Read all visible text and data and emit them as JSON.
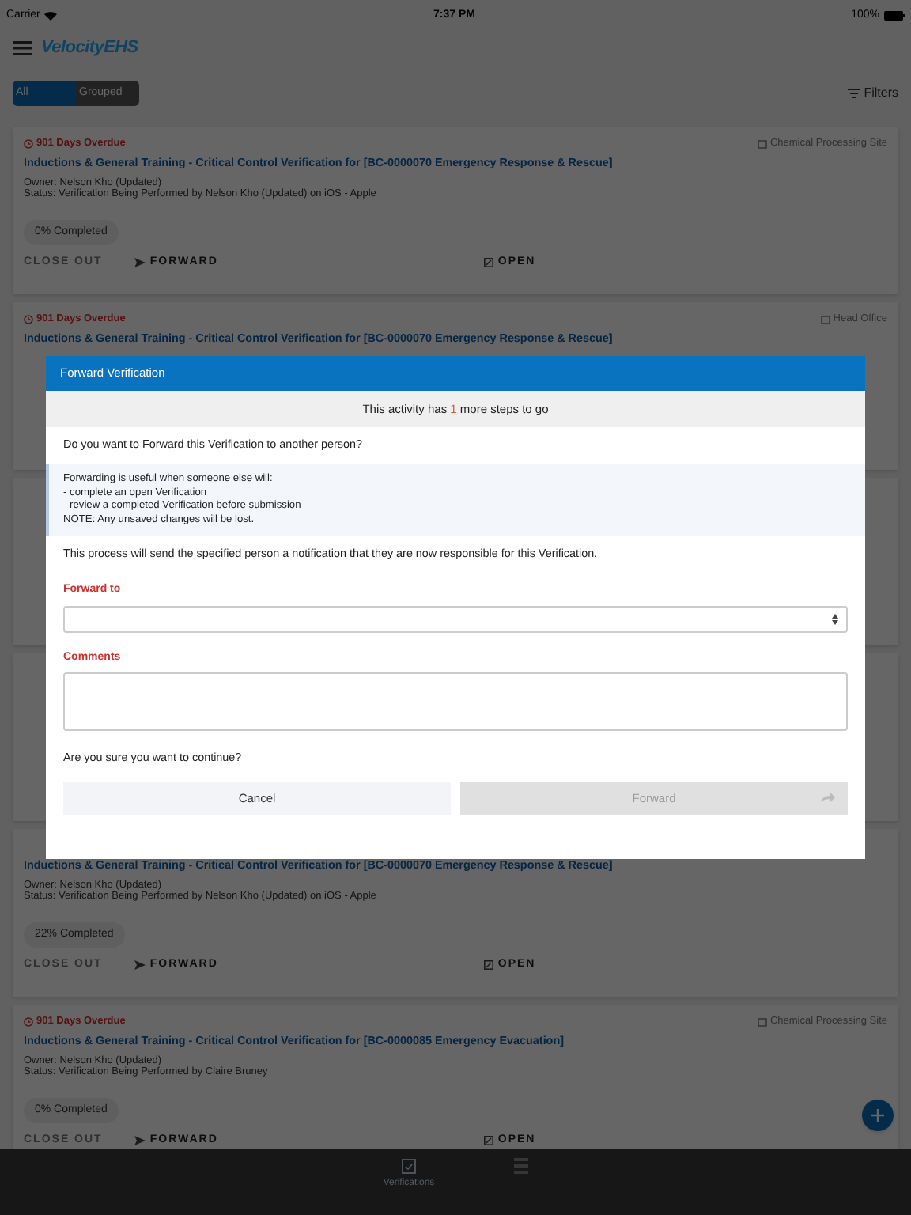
{
  "status_bar": {
    "carrier": "Carrier",
    "time": "7:37 PM",
    "battery": "100%"
  },
  "header": {
    "logo": "VelocityEHS"
  },
  "view_toggle": [
    {
      "label": "All",
      "selected": true
    },
    {
      "label": "Grouped",
      "selected": false
    }
  ],
  "filters": "Filters",
  "cards": [
    {
      "overdue": "901 Days Overdue",
      "site": "Chemical Processing Site",
      "title": "Inductions & General Training - Critical Control Verification for [BC-0000070 Emergency Response & Rescue]",
      "owner": "Owner: Nelson Kho (Updated)",
      "status": "Status: Verification Being Performed by Nelson Kho (Updated) on iOS - Apple",
      "progress": "0% Completed",
      "actions": [
        {
          "label": "CLOSE OUT",
          "kind": "close",
          "disabled": true
        },
        {
          "label": "FORWARD",
          "kind": "forward",
          "disabled": false
        },
        {
          "label": "OPEN",
          "kind": "open",
          "disabled": false
        }
      ]
    },
    {
      "overdue": "901 Days Overdue",
      "site": "Head Office",
      "title": "Inductions & General Training - Critical Control Verification for [BC-0000070 Emergency Response & Rescue]"
    },
    {
      "title": "Inductions & General Training - Critical Control Verification for [BC-0000070 Emergency Response & Rescue]",
      "owner": "Owner: Nelson Kho (Updated)",
      "status": "Status: Verification Being Performed by Nelson Kho (Updated) on iOS - Apple",
      "progress": "22% Completed",
      "actions": [
        {
          "label": "CLOSE OUT",
          "kind": "close",
          "disabled": true
        },
        {
          "label": "FORWARD",
          "kind": "forward",
          "disabled": false
        },
        {
          "label": "OPEN",
          "kind": "open",
          "disabled": false
        }
      ]
    },
    {
      "overdue": "901 Days Overdue",
      "site": "Chemical Processing Site",
      "title": "Inductions & General Training - Critical Control Verification for [BC-0000085 Emergency Evacuation]",
      "owner": "Owner: Nelson Kho (Updated)",
      "status": "Status: Verification Being Performed by Claire Bruney",
      "progress": "0% Completed",
      "actions": [
        {
          "label": "CLOSE OUT",
          "kind": "close",
          "disabled": true
        },
        {
          "label": "FORWARD",
          "kind": "forward",
          "disabled": false
        },
        {
          "label": "OPEN",
          "kind": "open",
          "disabled": false
        }
      ]
    }
  ],
  "tab_bar": [
    {
      "label": "Verifications",
      "selected": true
    },
    {
      "selected": false
    }
  ],
  "modal": {
    "title": "Forward Verification",
    "steps": [
      "This activity has ",
      "1",
      " more steps to go"
    ],
    "question": "Do you want to Forward this Verification to another person?",
    "info": [
      "Forwarding is useful when someone else will:",
      "- complete an open Verification",
      "- review a completed Verification before submission",
      "NOTE: Any unsaved changes will be lost."
    ],
    "notice": "This process will send the specified person a notification that they are now responsible for this Verification.",
    "forward_to_label": "Forward to",
    "comments_label": "Comments",
    "confirm": "Are you sure you want to continue?",
    "buttons": [
      {
        "label": "Cancel",
        "kind": "cancel",
        "disabled": false
      },
      {
        "label": "Forward",
        "kind": "forward",
        "disabled": true
      }
    ]
  }
}
